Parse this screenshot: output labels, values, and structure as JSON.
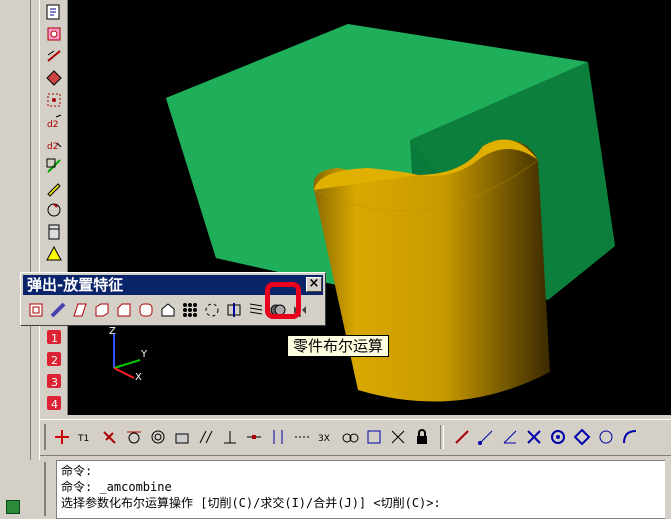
{
  "popup": {
    "title": "弹出-放置特征",
    "close_label": "×",
    "tools": [
      "extrude-icon",
      "pipe-icon",
      "loft-icon",
      "shell-icon",
      "chamfer-icon",
      "fillet-icon",
      "draft-icon",
      "pattern-icon",
      "rotate-pattern-icon",
      "split-icon",
      "thread-icon",
      "part-boolean-icon",
      "mirror-icon"
    ]
  },
  "tooltip": {
    "text": "零件布尔运算"
  },
  "command_line": {
    "lines": [
      "命令:",
      "命令: _amcombine",
      "选择参数化布尔运算操作 [切削(C)/求交(I)/合并(J)] <切削(C)>:"
    ]
  },
  "axes": {
    "x": "X",
    "y": "Y",
    "z": "Z"
  },
  "colors": {
    "cube": "#1fae5a",
    "cylinder": "#c99a00",
    "highlight": "#e8001c",
    "titlebar": "#0a246a"
  },
  "vtoolbar": {
    "badges": [
      "1",
      "2",
      "3",
      "4"
    ]
  }
}
